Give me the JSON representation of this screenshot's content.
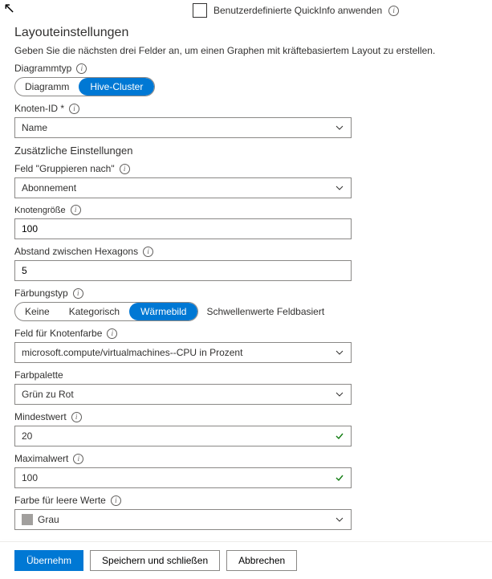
{
  "top_checkbox": {
    "label": "Benutzerdefinierte QuickInfo anwenden",
    "checked": false
  },
  "section": {
    "title": "Layouteinstellungen",
    "hint": "Geben Sie die nächsten drei Felder an, um einen Graphen mit kräftebasiertem Layout zu erstellen."
  },
  "diagramType": {
    "label": "Diagrammtyp",
    "options": [
      "Diagramm",
      "Hive-Cluster"
    ],
    "selected": "Hive-Cluster"
  },
  "nodeId": {
    "label": "Knoten-ID *",
    "value": "Name"
  },
  "additionalHeader": "Zusätzliche Einstellungen",
  "groupBy": {
    "label": "Feld \"Gruppieren nach\"",
    "value": "Abonnement"
  },
  "nodeSize": {
    "label": "Knotengröße",
    "value": "100"
  },
  "hexSpacing": {
    "label": "Abstand zwischen Hexagons",
    "value": "5"
  },
  "colorType": {
    "label": "Färbungstyp",
    "options": [
      "Keine",
      "Kategorisch",
      "Wärmebild"
    ],
    "selected": "Wärmebild",
    "trailing": "Schwellenwerte Feldbasiert"
  },
  "colorField": {
    "label": "Feld für Knotenfarbe",
    "value": "microsoft.compute/virtualmachines--CPU in Prozent"
  },
  "palette": {
    "label": "Farbpalette",
    "value": "Grün zu Rot"
  },
  "minVal": {
    "label": "Mindestwert",
    "value": "20"
  },
  "maxVal": {
    "label": "Maximalwert",
    "value": "100"
  },
  "emptyColor": {
    "label": "Farbe für leere Werte",
    "value": "Grau",
    "swatch": "#a19f9d"
  },
  "footer": {
    "apply": "Übernehm",
    "saveClose": "Speichern und schließen",
    "cancel": "Abbrechen"
  }
}
